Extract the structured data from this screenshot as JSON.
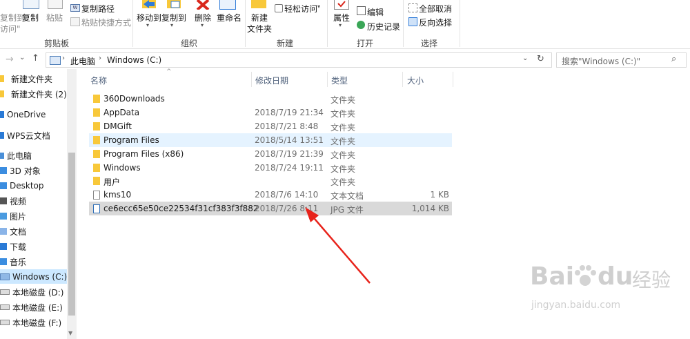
{
  "ribbon": {
    "cut_partial": "复制到\"",
    "cut_partial2": "访问\"",
    "copy_label": "复制",
    "paste_label": "粘贴",
    "copy_path": "复制路径",
    "paste_shortcut": "粘贴快捷方式",
    "clipboard_group": "剪贴板",
    "move_to": "移动到",
    "copy_to": "复制到",
    "delete": "删除",
    "rename": "重命名",
    "organize_group": "组织",
    "new_folder_line1": "新建",
    "new_folder_line2": "文件夹",
    "easy_access": "轻松访问",
    "new_group": "新建",
    "properties": "属性",
    "edit": "编辑",
    "history": "历史记录",
    "open_group": "打开",
    "select_none": "全部取消",
    "invert_selection": "反向选择",
    "select_group": "选择"
  },
  "address": {
    "crumb_1": "此电脑",
    "crumb_2": "Windows (C:)",
    "search_placeholder": "搜索\"Windows (C:)\""
  },
  "sidebar": {
    "items": [
      {
        "label": "新建文件夹"
      },
      {
        "label": "新建文件夹 (2)"
      },
      {
        "label": "OneDrive"
      },
      {
        "label": "WPS云文档"
      },
      {
        "label": "此电脑"
      },
      {
        "label": "3D 对象"
      },
      {
        "label": "Desktop"
      },
      {
        "label": "视频"
      },
      {
        "label": "图片"
      },
      {
        "label": "文档"
      },
      {
        "label": "下载"
      },
      {
        "label": "音乐"
      },
      {
        "label": "Windows (C:)"
      },
      {
        "label": "本地磁盘 (D:)"
      },
      {
        "label": "本地磁盘 (E:)"
      },
      {
        "label": "本地磁盘 (F:)"
      }
    ]
  },
  "columns": {
    "name": "名称",
    "date": "修改日期",
    "type": "类型",
    "size": "大小"
  },
  "files": [
    {
      "name": "360Downloads",
      "date": "",
      "type": "文件夹",
      "size": ""
    },
    {
      "name": "AppData",
      "date": "2018/7/19 21:34",
      "type": "文件夹",
      "size": ""
    },
    {
      "name": "DMGift",
      "date": "2018/7/21 8:48",
      "type": "文件夹",
      "size": ""
    },
    {
      "name": "Program Files",
      "date": "2018/5/14 13:51",
      "type": "文件夹",
      "size": ""
    },
    {
      "name": "Program Files (x86)",
      "date": "2018/7/19 21:39",
      "type": "文件夹",
      "size": ""
    },
    {
      "name": "Windows",
      "date": "2018/7/24 19:11",
      "type": "文件夹",
      "size": ""
    },
    {
      "name": "用户",
      "date": "",
      "type": "文件夹",
      "size": ""
    },
    {
      "name": "kms10",
      "date": "2018/7/6 14:10",
      "type": "文本文档",
      "size": "1 KB"
    },
    {
      "name": "ce6ecc65e50ce22534f31cf383f3f882",
      "date": "2018/7/26 8:11",
      "type": "JPG 文件",
      "size": "1,014 KB"
    }
  ],
  "watermark": {
    "brand": "Bai",
    "brand2": "du",
    "cn": "经验",
    "url": "jingyan.baidu.com"
  },
  "colors": {
    "folder": "#f8c83a",
    "hover_row": "#e5f3ff",
    "selected_row": "#d9d9d9",
    "arrow": "#e8231b"
  }
}
